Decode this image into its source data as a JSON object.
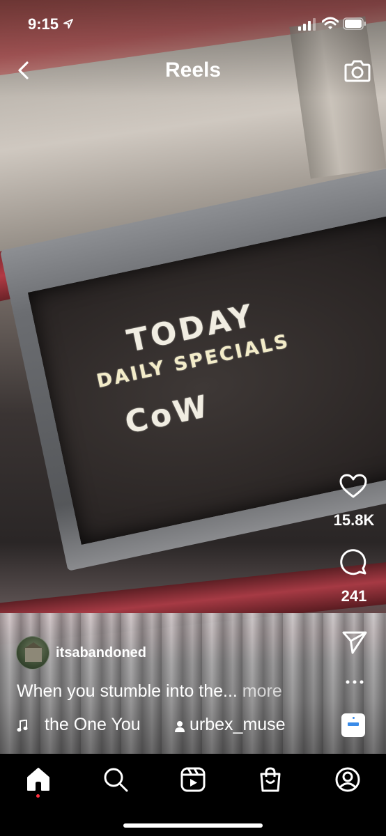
{
  "status_bar": {
    "time": "9:15"
  },
  "header": {
    "title": "Reels"
  },
  "video": {
    "sign_lines": [
      "TODAY",
      "DAILY SPECIALS",
      "CoW"
    ]
  },
  "actions": {
    "likes": "15.8K",
    "comments": "241"
  },
  "post": {
    "username": "itsabandoned",
    "caption": "When you stumble into the...",
    "more_label": "more",
    "audio": "the One You",
    "collaborator": "urbex_muse"
  },
  "tabs": [
    "home",
    "search",
    "reels",
    "shop",
    "profile"
  ],
  "colors": {
    "notification_dot": "#ff3040",
    "background": "#000000",
    "foreground": "#ffffff"
  },
  "icons": [
    "location-arrow-icon",
    "cellular-signal-icon",
    "wifi-icon",
    "battery-icon",
    "back-chevron-icon",
    "camera-icon",
    "heart-icon",
    "comment-icon",
    "send-icon",
    "more-icon",
    "music-note-icon",
    "person-icon",
    "home-icon",
    "search-icon",
    "reels-icon",
    "shopping-bag-icon",
    "profile-icon"
  ]
}
